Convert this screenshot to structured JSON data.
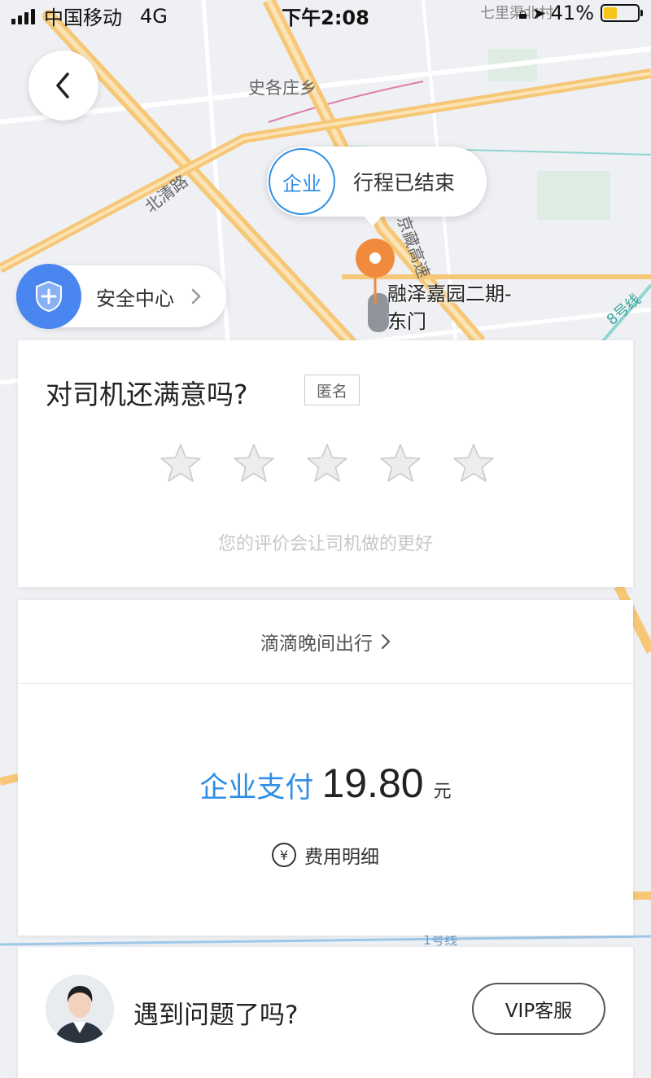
{
  "status_bar": {
    "carrier": "中国移动",
    "network": "4G",
    "time": "下午2:08",
    "battery_percent": "41%",
    "battery_level": 0.41
  },
  "map": {
    "labels": [
      "史各庄乡",
      "北清路",
      "七里渠北村",
      "8号线",
      "1号线"
    ],
    "route_label": "京藏高速"
  },
  "trip_bubble": {
    "enterprise_tag": "企业",
    "status": "行程已结束"
  },
  "destination": {
    "name_line1": "融泽嘉园二期-",
    "name_line2": "东门"
  },
  "safety": {
    "label": "安全中心"
  },
  "rating": {
    "title": "对司机还满意吗?",
    "anonymous_tag": "匿名",
    "stars_total": 5,
    "stars_selected": 0,
    "hint": "您的评价会让司机做的更好"
  },
  "payment": {
    "night_service": "滴滴晚间出行",
    "method": "企业支付",
    "amount": "19.80",
    "unit": "元",
    "yen_symbol": "¥",
    "fee_detail": "费用明细"
  },
  "help": {
    "question": "遇到问题了吗?",
    "vip_button": "VIP客服"
  },
  "colors": {
    "accent_blue": "#2e8ee6",
    "pin_orange": "#f08a3c",
    "road_yellow": "#f6c776",
    "shield_blue": "#4a86f0"
  }
}
